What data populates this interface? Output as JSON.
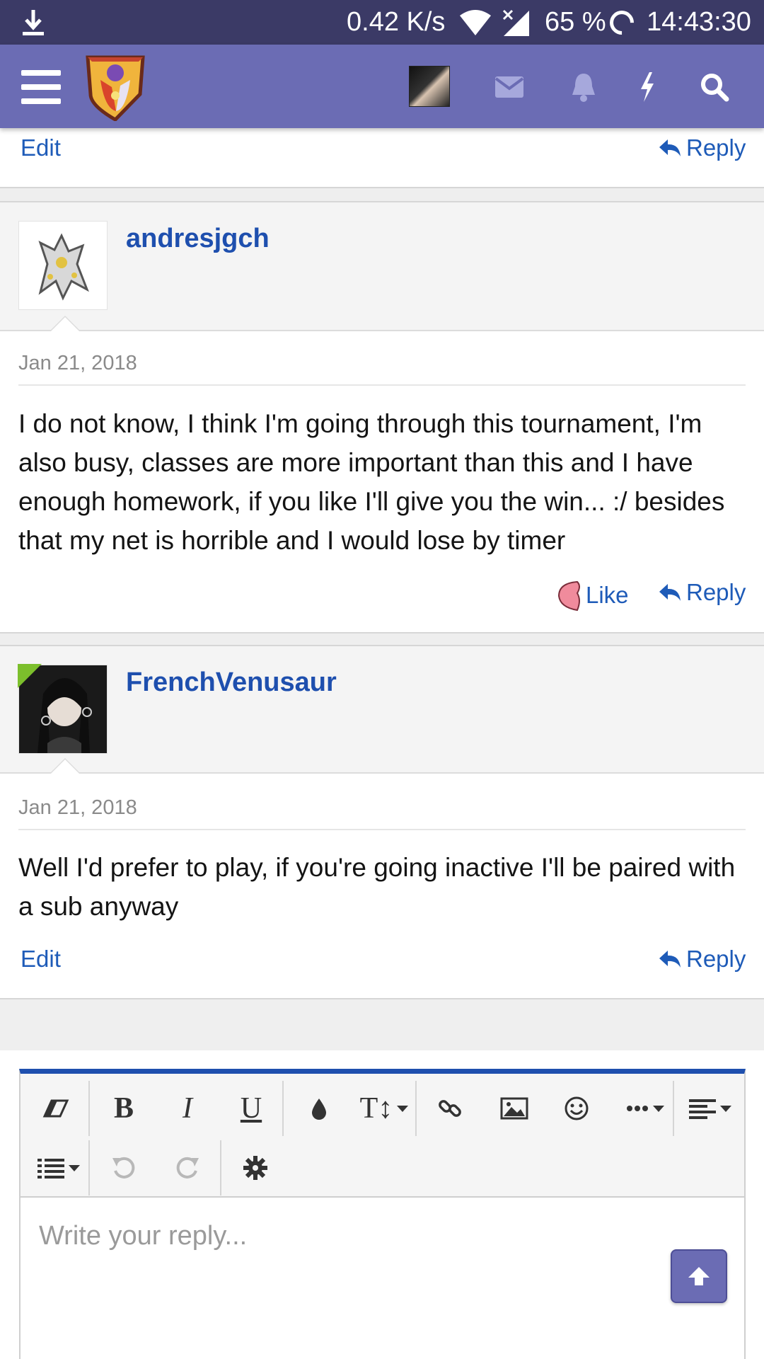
{
  "status_bar": {
    "speed": "0.42 K/s",
    "battery": "65 %",
    "time": "14:43:30"
  },
  "header": {
    "icons": [
      "menu-icon",
      "site-logo",
      "user-avatar",
      "mail-icon",
      "bell-icon",
      "bolt-icon",
      "search-icon"
    ]
  },
  "top_post": {
    "edit_label": "Edit",
    "reply_label": "Reply"
  },
  "posts": [
    {
      "username": "andresjgch",
      "date": "Jan 21, 2018",
      "text": "I do not know, I think I'm going through this tournament, I'm also busy, classes are more important than this and I have enough homework, if you like I'll give you the win... :/ besides that my net is horrible and I would lose by timer",
      "like_label": "Like",
      "reply_label": "Reply"
    },
    {
      "username": "FrenchVenusaur",
      "date": "Jan 21, 2018",
      "text": "Well I'd prefer to play, if you're going inactive I'll be paired with a sub anyway",
      "edit_label": "Edit",
      "reply_label": "Reply"
    }
  ],
  "editor": {
    "placeholder": "Write your reply...",
    "toolbar": {
      "bold": "B",
      "italic": "I",
      "underline": "U",
      "text_size": "T↕"
    }
  },
  "colors": {
    "status_bar": "#3b3a66",
    "header": "#6b6cb4",
    "link": "#1e5bb8",
    "username": "#1e4fae"
  }
}
